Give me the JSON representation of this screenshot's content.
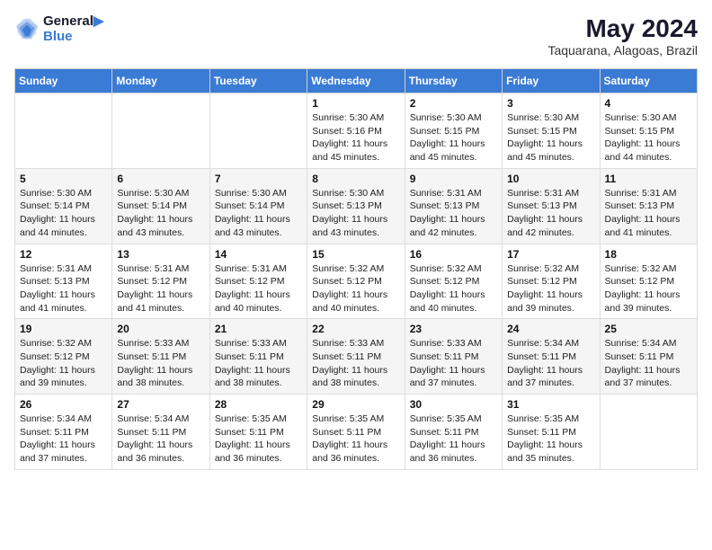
{
  "header": {
    "logo_line1": "General",
    "logo_line2": "Blue",
    "month_year": "May 2024",
    "location": "Taquarana, Alagoas, Brazil"
  },
  "weekdays": [
    "Sunday",
    "Monday",
    "Tuesday",
    "Wednesday",
    "Thursday",
    "Friday",
    "Saturday"
  ],
  "weeks": [
    [
      {
        "day": "",
        "info": ""
      },
      {
        "day": "",
        "info": ""
      },
      {
        "day": "",
        "info": ""
      },
      {
        "day": "1",
        "info": "Sunrise: 5:30 AM\nSunset: 5:16 PM\nDaylight: 11 hours\nand 45 minutes."
      },
      {
        "day": "2",
        "info": "Sunrise: 5:30 AM\nSunset: 5:15 PM\nDaylight: 11 hours\nand 45 minutes."
      },
      {
        "day": "3",
        "info": "Sunrise: 5:30 AM\nSunset: 5:15 PM\nDaylight: 11 hours\nand 45 minutes."
      },
      {
        "day": "4",
        "info": "Sunrise: 5:30 AM\nSunset: 5:15 PM\nDaylight: 11 hours\nand 44 minutes."
      }
    ],
    [
      {
        "day": "5",
        "info": "Sunrise: 5:30 AM\nSunset: 5:14 PM\nDaylight: 11 hours\nand 44 minutes."
      },
      {
        "day": "6",
        "info": "Sunrise: 5:30 AM\nSunset: 5:14 PM\nDaylight: 11 hours\nand 43 minutes."
      },
      {
        "day": "7",
        "info": "Sunrise: 5:30 AM\nSunset: 5:14 PM\nDaylight: 11 hours\nand 43 minutes."
      },
      {
        "day": "8",
        "info": "Sunrise: 5:30 AM\nSunset: 5:13 PM\nDaylight: 11 hours\nand 43 minutes."
      },
      {
        "day": "9",
        "info": "Sunrise: 5:31 AM\nSunset: 5:13 PM\nDaylight: 11 hours\nand 42 minutes."
      },
      {
        "day": "10",
        "info": "Sunrise: 5:31 AM\nSunset: 5:13 PM\nDaylight: 11 hours\nand 42 minutes."
      },
      {
        "day": "11",
        "info": "Sunrise: 5:31 AM\nSunset: 5:13 PM\nDaylight: 11 hours\nand 41 minutes."
      }
    ],
    [
      {
        "day": "12",
        "info": "Sunrise: 5:31 AM\nSunset: 5:13 PM\nDaylight: 11 hours\nand 41 minutes."
      },
      {
        "day": "13",
        "info": "Sunrise: 5:31 AM\nSunset: 5:12 PM\nDaylight: 11 hours\nand 41 minutes."
      },
      {
        "day": "14",
        "info": "Sunrise: 5:31 AM\nSunset: 5:12 PM\nDaylight: 11 hours\nand 40 minutes."
      },
      {
        "day": "15",
        "info": "Sunrise: 5:32 AM\nSunset: 5:12 PM\nDaylight: 11 hours\nand 40 minutes."
      },
      {
        "day": "16",
        "info": "Sunrise: 5:32 AM\nSunset: 5:12 PM\nDaylight: 11 hours\nand 40 minutes."
      },
      {
        "day": "17",
        "info": "Sunrise: 5:32 AM\nSunset: 5:12 PM\nDaylight: 11 hours\nand 39 minutes."
      },
      {
        "day": "18",
        "info": "Sunrise: 5:32 AM\nSunset: 5:12 PM\nDaylight: 11 hours\nand 39 minutes."
      }
    ],
    [
      {
        "day": "19",
        "info": "Sunrise: 5:32 AM\nSunset: 5:12 PM\nDaylight: 11 hours\nand 39 minutes."
      },
      {
        "day": "20",
        "info": "Sunrise: 5:33 AM\nSunset: 5:11 PM\nDaylight: 11 hours\nand 38 minutes."
      },
      {
        "day": "21",
        "info": "Sunrise: 5:33 AM\nSunset: 5:11 PM\nDaylight: 11 hours\nand 38 minutes."
      },
      {
        "day": "22",
        "info": "Sunrise: 5:33 AM\nSunset: 5:11 PM\nDaylight: 11 hours\nand 38 minutes."
      },
      {
        "day": "23",
        "info": "Sunrise: 5:33 AM\nSunset: 5:11 PM\nDaylight: 11 hours\nand 37 minutes."
      },
      {
        "day": "24",
        "info": "Sunrise: 5:34 AM\nSunset: 5:11 PM\nDaylight: 11 hours\nand 37 minutes."
      },
      {
        "day": "25",
        "info": "Sunrise: 5:34 AM\nSunset: 5:11 PM\nDaylight: 11 hours\nand 37 minutes."
      }
    ],
    [
      {
        "day": "26",
        "info": "Sunrise: 5:34 AM\nSunset: 5:11 PM\nDaylight: 11 hours\nand 37 minutes."
      },
      {
        "day": "27",
        "info": "Sunrise: 5:34 AM\nSunset: 5:11 PM\nDaylight: 11 hours\nand 36 minutes."
      },
      {
        "day": "28",
        "info": "Sunrise: 5:35 AM\nSunset: 5:11 PM\nDaylight: 11 hours\nand 36 minutes."
      },
      {
        "day": "29",
        "info": "Sunrise: 5:35 AM\nSunset: 5:11 PM\nDaylight: 11 hours\nand 36 minutes."
      },
      {
        "day": "30",
        "info": "Sunrise: 5:35 AM\nSunset: 5:11 PM\nDaylight: 11 hours\nand 36 minutes."
      },
      {
        "day": "31",
        "info": "Sunrise: 5:35 AM\nSunset: 5:11 PM\nDaylight: 11 hours\nand 35 minutes."
      },
      {
        "day": "",
        "info": ""
      }
    ]
  ]
}
